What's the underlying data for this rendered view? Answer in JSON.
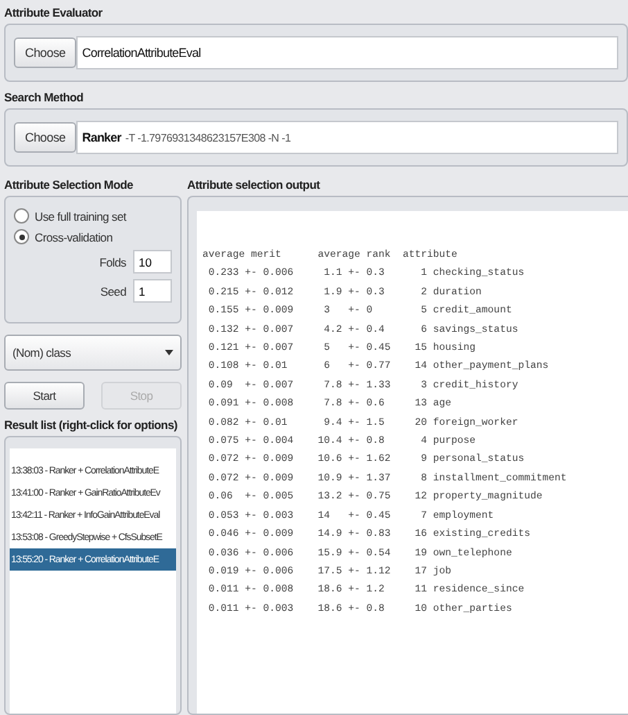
{
  "evaluator": {
    "title": "Attribute Evaluator",
    "button": "Choose",
    "value": "CorrelationAttributeEval"
  },
  "search": {
    "title": "Search Method",
    "button": "Choose",
    "name": "Ranker",
    "options": "-T -1.7976931348623157E308 -N -1"
  },
  "mode": {
    "title": "Attribute Selection Mode",
    "options": [
      {
        "label": "Use full training set",
        "selected": false
      },
      {
        "label": "Cross-validation",
        "selected": true
      }
    ],
    "fields": [
      {
        "label": "Folds",
        "value": "10"
      },
      {
        "label": "Seed",
        "value": "1"
      }
    ]
  },
  "class_select": {
    "value": "(Nom) class"
  },
  "buttons": [
    {
      "label": "Start",
      "disabled": false
    },
    {
      "label": "Stop",
      "disabled": true
    }
  ],
  "results": {
    "title": "Result list (right-click for options)",
    "items": [
      {
        "label": "13:38:03 - Ranker + CorrelationAttributeE",
        "selected": false
      },
      {
        "label": "13:41:00 - Ranker + GainRatioAttributeEv",
        "selected": false
      },
      {
        "label": "13:42:11 - Ranker + InfoGainAttributeEval",
        "selected": false
      },
      {
        "label": "13:53:08 - GreedyStepwise + CfsSubsetE",
        "selected": false
      },
      {
        "label": "13:55:20 - Ranker + CorrelationAttributeE",
        "selected": true
      }
    ]
  },
  "output": {
    "title": "Attribute selection output",
    "lines": [
      "average merit      average rank  attribute",
      " 0.233 +- 0.006     1.1 +- 0.3      1 checking_status",
      " 0.215 +- 0.012     1.9 +- 0.3      2 duration",
      " 0.155 +- 0.009     3   +- 0        5 credit_amount",
      " 0.132 +- 0.007     4.2 +- 0.4      6 savings_status",
      " 0.121 +- 0.007     5   +- 0.45    15 housing",
      " 0.108 +- 0.01      6   +- 0.77    14 other_payment_plans",
      " 0.09  +- 0.007     7.8 +- 1.33     3 credit_history",
      " 0.091 +- 0.008     7.8 +- 0.6     13 age",
      " 0.082 +- 0.01      9.4 +- 1.5     20 foreign_worker",
      " 0.075 +- 0.004    10.4 +- 0.8      4 purpose",
      " 0.072 +- 0.009    10.6 +- 1.62     9 personal_status",
      " 0.072 +- 0.009    10.9 +- 1.37     8 installment_commitment",
      " 0.06  +- 0.005    13.2 +- 0.75    12 property_magnitude",
      " 0.053 +- 0.003    14   +- 0.45     7 employment",
      " 0.046 +- 0.009    14.9 +- 0.83    16 existing_credits",
      " 0.036 +- 0.006    15.9 +- 0.54    19 own_telephone",
      " 0.019 +- 0.006    17.5 +- 1.12    17 job",
      " 0.011 +- 0.008    18.6 +- 1.2     11 residence_since",
      " 0.011 +- 0.003    18.6 +- 0.8     10 other_parties"
    ]
  }
}
